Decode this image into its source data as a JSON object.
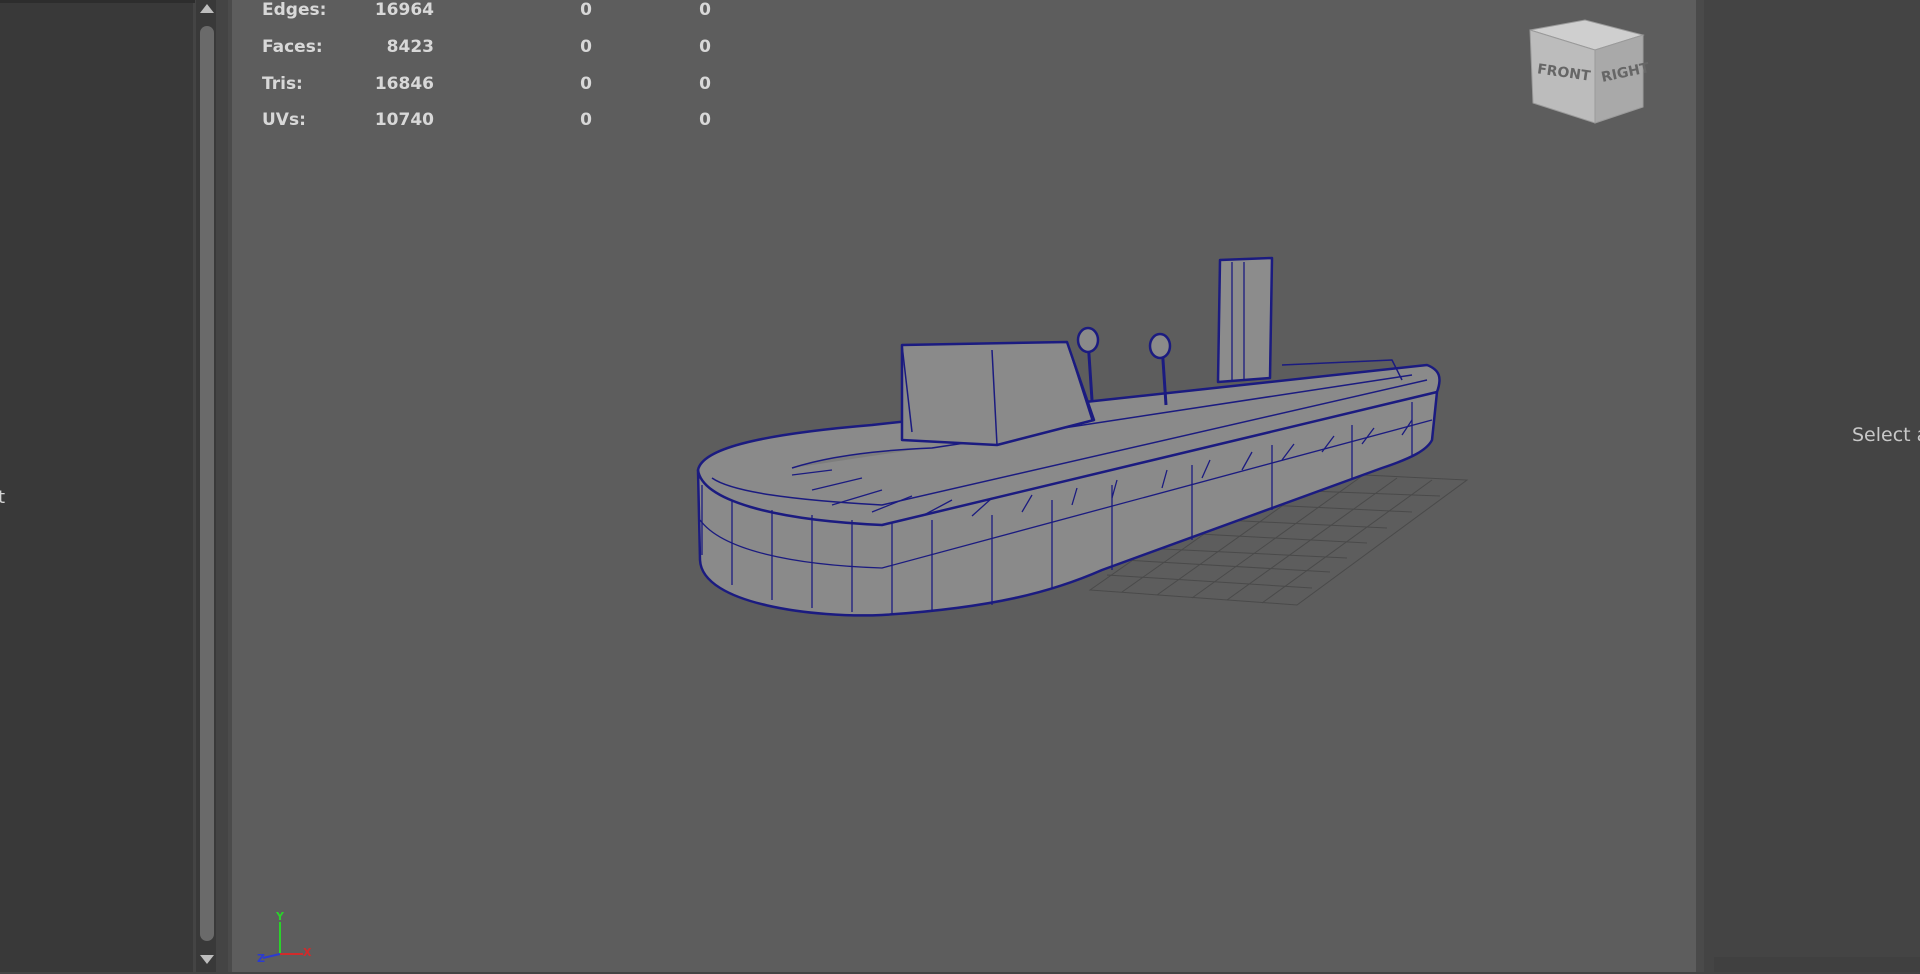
{
  "outliner": {
    "clipped_text": "t"
  },
  "hud": {
    "rows": [
      {
        "label": "Edges:",
        "v1": "16964",
        "v2": "0",
        "v3": "0"
      },
      {
        "label": "Faces:",
        "v1": "8423",
        "v2": "0",
        "v3": "0"
      },
      {
        "label": "Tris:",
        "v1": "16846",
        "v2": "0",
        "v3": "0"
      },
      {
        "label": "UVs:",
        "v1": "10740",
        "v2": "0",
        "v3": "0"
      }
    ]
  },
  "view_cube": {
    "front": "FRONT",
    "right": "RIGHT"
  },
  "axis": {
    "y": "Y",
    "x": "X",
    "z": "Z"
  },
  "attribute_panel": {
    "clipped_text": "Select a"
  },
  "colors": {
    "viewport_bg": "#5d5d5d",
    "wireframe": "#1a1a7a",
    "panel_bg": "#393939"
  }
}
